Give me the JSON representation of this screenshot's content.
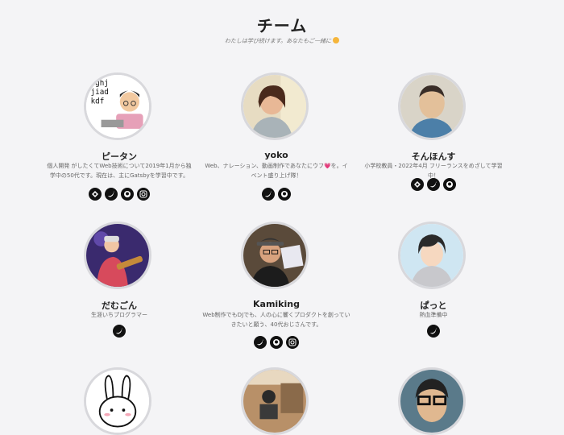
{
  "page": {
    "title": "チーム",
    "tagline": "わたしは学び続けます。あなたもご一緒に"
  },
  "members": [
    {
      "name": "ピータン",
      "bio": "個人開発 がしたくてWeb技術について2019年1月から独学中の50代です。現在は、主にGatsbyを学習中です。",
      "socials": [
        "gatsby-icon",
        "twitter-icon",
        "github-icon",
        "instagram-icon"
      ]
    },
    {
      "name": "yoko",
      "bio": "Web、ナレーション、動画制作であなたにウフ💗を。イベント盛り上げ隊！",
      "socials": [
        "twitter-icon",
        "github-icon"
      ]
    },
    {
      "name": "そんほんす",
      "bio": "小学校教員・2022年4月 フリーランスをめざして学習中！",
      "socials": [
        "gatsby-icon",
        "twitter-icon",
        "github-icon"
      ]
    },
    {
      "name": "だむごん",
      "bio": "生涯いちプログラマー",
      "socials": [
        "twitter-icon"
      ]
    },
    {
      "name": "Kamiking",
      "bio": "Web制作でもDJでも、人の心に響くプロダクトを創っていきたいと願う、40代おじさんです。",
      "socials": [
        "twitter-icon",
        "github-icon",
        "instagram-icon"
      ]
    },
    {
      "name": "ぱっと",
      "bio": "熱血準備中",
      "socials": [
        "twitter-icon"
      ]
    }
  ],
  "colors": {
    "background": "#f4f4f6",
    "social": "#111111",
    "avatar_border": "#d8d8dc"
  }
}
